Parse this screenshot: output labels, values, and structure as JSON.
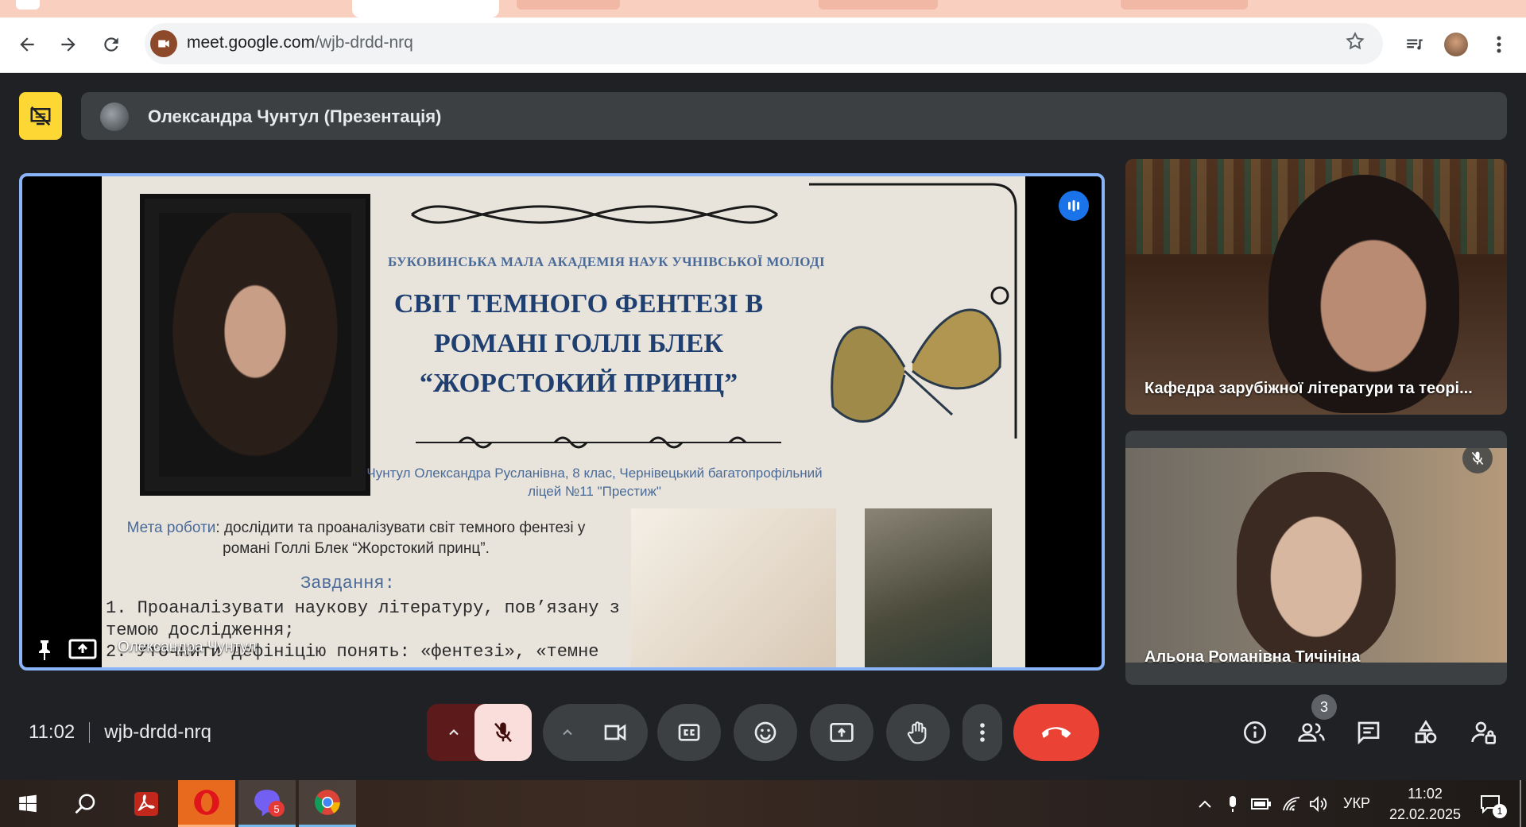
{
  "browser": {
    "url_host": "meet.google.com",
    "url_path": "/wjb-drdd-nrq"
  },
  "presenter": {
    "label": "Олександра Чунтул (Презентація)"
  },
  "slide": {
    "org": "БУКОВИНСЬКА МАЛА АКАДЕМІЯ НАУК УЧНІВСЬКОЇ МОЛОДІ",
    "title_lines": [
      "СВІТ ТЕМНОГО ФЕНТЕЗІ В",
      "РОМАНІ ГОЛЛІ БЛЕК",
      "“ЖОРСТОКИЙ ПРИНЦ”"
    ],
    "author_line1": "Чунтул Олександра Русланівна, 8 клас, Чернівецький багатопрофільний",
    "author_line2": "ліцей №11 \"Престиж\"",
    "goal_label": "Мета роботи",
    "goal_text": ": дослідити та проаналізувати світ темного фентезі у романі Голлі Блек “Жорстокий принц”.",
    "tasks_heading": "Завдання:",
    "task1": "1. Проаналізувати наукову літературу, пов’язану з темою дослідження;",
    "task2": "2. Уточнити дефініцію понять: «фентезі», «темне"
  },
  "main_tile": {
    "name": "Олександра Чунтул"
  },
  "participants": [
    {
      "name": "Кафедра зарубіжної літератури та теорі..."
    },
    {
      "name": "Альона Романівна Тичініна"
    }
  ],
  "meeting": {
    "time": "11:02",
    "code": "wjb-drdd-nrq",
    "people_count": "3"
  },
  "taskbar": {
    "viber_badge": "5",
    "language": "УКР",
    "clock_time": "11:02",
    "clock_date": "22.02.2025",
    "notification_count": "1"
  },
  "colors": {
    "meet_bg": "#202124",
    "accent_blue": "#8ab4f8",
    "end_call_red": "#ea4335",
    "present_yellow": "#fdd835",
    "tab_strip": "#f9cfc0"
  }
}
